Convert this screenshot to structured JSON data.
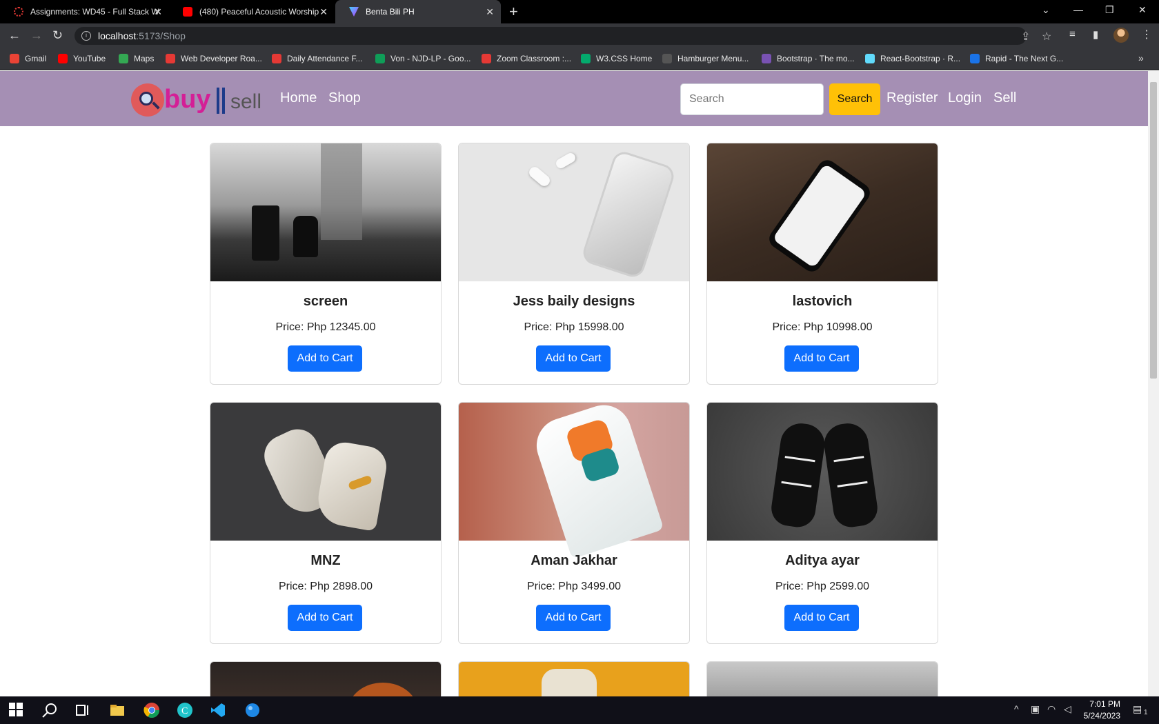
{
  "browser": {
    "tabs": [
      {
        "title": "Assignments: WD45 - Full Stack W",
        "active": false
      },
      {
        "title": "(480) Peaceful Acoustic Worship",
        "active": false
      },
      {
        "title": "Benta Bili PH",
        "active": true
      }
    ],
    "new_tab": "+",
    "window_controls": [
      "⌄",
      "—",
      "❐",
      "✕"
    ],
    "address": {
      "host": "localhost",
      "path": ":5173/Shop"
    },
    "bookmarks": [
      "Gmail",
      "YouTube",
      "Maps",
      "Web Developer Roa...",
      "Daily Attendance F...",
      "Von - NJD-LP - Goo...",
      "Zoom Classroom :...",
      "W3.CSS Home",
      "Hamburger Menu...",
      "Bootstrap · The mo...",
      "React-Bootstrap · R...",
      "Rapid - The Next G..."
    ],
    "bookmark_colors": [
      "#ea4335",
      "#ff0000",
      "#34a853",
      "#e53935",
      "#e53935",
      "#0f9d58",
      "#e53935",
      "#04aa6d",
      "#555555",
      "#7952b3",
      "#61dafb",
      "#1a73e8"
    ],
    "more": "»"
  },
  "site": {
    "logo": {
      "word_buy": "buy",
      "word_sell": "sell"
    },
    "nav": {
      "home": "Home",
      "shop": "Shop",
      "register": "Register",
      "login": "Login",
      "sell": "Sell"
    },
    "search": {
      "placeholder": "Search",
      "button": "Search"
    },
    "colors": {
      "navbar": "#a58fb4",
      "search_button": "#ffc107",
      "add_button": "#0d6efd"
    }
  },
  "products": [
    {
      "name": "screen",
      "price": "Price: Php 12345.00",
      "button": "Add to Cart"
    },
    {
      "name": "Jess baily designs",
      "price": "Price: Php 15998.00",
      "button": "Add to Cart"
    },
    {
      "name": "lastovich",
      "price": "Price: Php 10998.00",
      "button": "Add to Cart"
    },
    {
      "name": "MNZ",
      "price": "Price: Php 2898.00",
      "button": "Add to Cart"
    },
    {
      "name": "Aman Jakhar",
      "price": "Price: Php 3499.00",
      "button": "Add to Cart"
    },
    {
      "name": "Aditya ayar",
      "price": "Price: Php 2599.00",
      "button": "Add to Cart"
    }
  ],
  "taskbar": {
    "time": "7:01 PM",
    "date": "5/24/2023",
    "notification_count": "1"
  }
}
